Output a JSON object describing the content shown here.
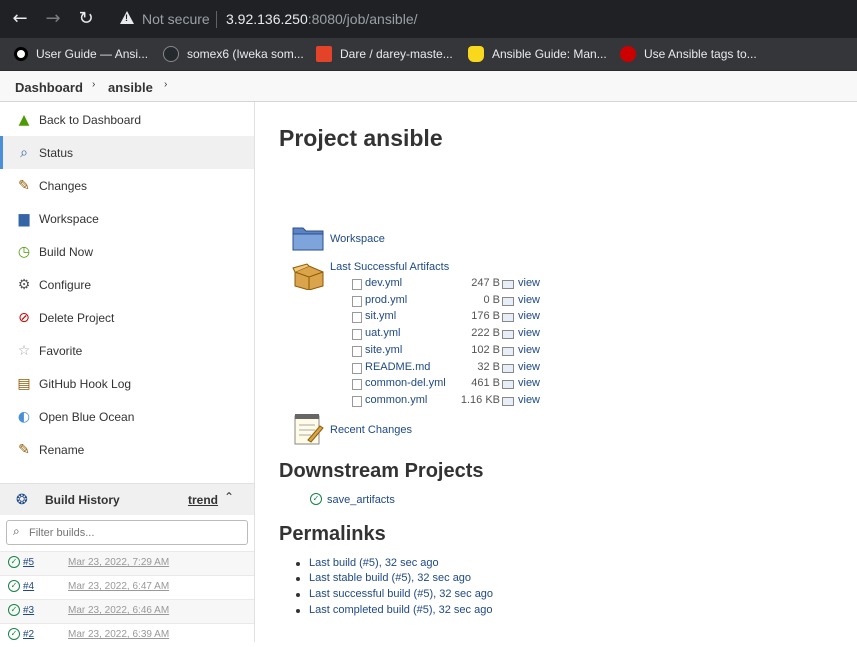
{
  "browser": {
    "not_secure": "Not secure",
    "url_host": "3.92.136.250",
    "url_rest": ":8080/job/ansible/",
    "bookmarks": [
      {
        "label": "User Guide — Ansi...",
        "color": "#ffffff"
      },
      {
        "label": "somex6 (Iweka som...",
        "color": "#24292e"
      },
      {
        "label": "Dare / darey-maste...",
        "color": "#e24329"
      },
      {
        "label": "Ansible Guide: Man...",
        "color": "#f9d71c"
      },
      {
        "label": "Use Ansible tags to...",
        "color": "#cc0000"
      }
    ]
  },
  "breadcrumb": {
    "dashboard": "Dashboard",
    "job": "ansible"
  },
  "sidebar": {
    "tasks": [
      {
        "label": "Back to Dashboard",
        "icon": "arrow-up-icon"
      },
      {
        "label": "Status",
        "icon": "magnifier-icon"
      },
      {
        "label": "Changes",
        "icon": "notepad-icon"
      },
      {
        "label": "Workspace",
        "icon": "folder-icon"
      },
      {
        "label": "Build Now",
        "icon": "clock-icon"
      },
      {
        "label": "Configure",
        "icon": "gear-icon"
      },
      {
        "label": "Delete Project",
        "icon": "no-entry-icon"
      },
      {
        "label": "Favorite",
        "icon": "star-icon"
      },
      {
        "label": "GitHub Hook Log",
        "icon": "log-icon"
      },
      {
        "label": "Open Blue Ocean",
        "icon": "blue-ocean-icon"
      },
      {
        "label": "Rename",
        "icon": "notepad-icon"
      }
    ],
    "build_history": {
      "title": "Build History",
      "trend": "trend",
      "filter_placeholder": "Filter builds...",
      "builds": [
        {
          "number": "#5",
          "date": "Mar 23, 2022, 7:29 AM"
        },
        {
          "number": "#4",
          "date": "Mar 23, 2022, 6:47 AM"
        },
        {
          "number": "#3",
          "date": "Mar 23, 2022, 6:46 AM"
        },
        {
          "number": "#2",
          "date": "Mar 23, 2022, 6:39 AM"
        }
      ]
    }
  },
  "main": {
    "title": "Project ansible",
    "workspace": "Workspace",
    "last_artifacts": "Last Successful Artifacts",
    "artifacts": [
      {
        "name": "dev.yml",
        "size": "247 B"
      },
      {
        "name": "prod.yml",
        "size": "0 B"
      },
      {
        "name": "sit.yml",
        "size": "176 B"
      },
      {
        "name": "uat.yml",
        "size": "222 B"
      },
      {
        "name": "site.yml",
        "size": "102 B"
      },
      {
        "name": "README.md",
        "size": "32 B"
      },
      {
        "name": "common-del.yml",
        "size": "461 B"
      },
      {
        "name": "common.yml",
        "size": "1.16 KB"
      }
    ],
    "view_label": "view",
    "recent_changes": "Recent Changes",
    "downstream_title": "Downstream Projects",
    "downstream": [
      "save_artifacts"
    ],
    "permalinks_title": "Permalinks",
    "permalinks": [
      "Last build (#5), 32 sec ago",
      "Last stable build (#5), 32 sec ago",
      "Last successful build (#5), 32 sec ago",
      "Last completed build (#5), 32 sec ago"
    ]
  }
}
